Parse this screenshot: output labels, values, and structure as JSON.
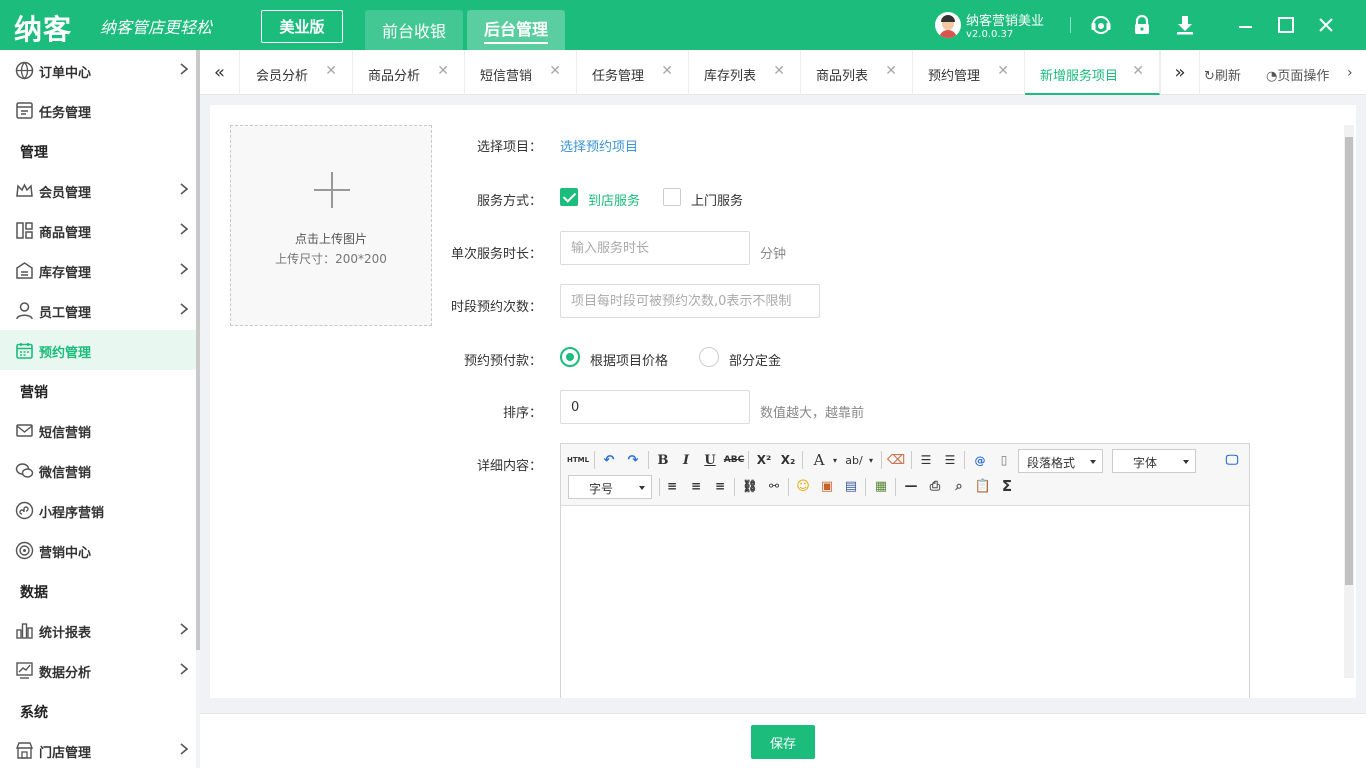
{
  "header": {
    "logo": "纳客",
    "slogan": "纳客管店更轻松",
    "edition": "美业版",
    "front_tab": "前台收银",
    "back_tab": "后台管理",
    "user_name": "纳客营销美业",
    "version": "v2.0.0.37",
    "icons": [
      "support-icon",
      "lock-icon",
      "download-icon",
      "minimize-icon",
      "maximize-icon",
      "close-icon"
    ]
  },
  "sidebar": {
    "items": [
      {
        "label": "订单中心",
        "icon": "globe-icon",
        "chevron": true
      },
      {
        "label": "任务管理",
        "icon": "task-icon",
        "chevron": false
      },
      {
        "label": "会员管理",
        "icon": "crown-icon",
        "chevron": true
      },
      {
        "label": "商品管理",
        "icon": "goods-icon",
        "chevron": true
      },
      {
        "label": "库存管理",
        "icon": "warehouse-icon",
        "chevron": true
      },
      {
        "label": "员工管理",
        "icon": "person-icon",
        "chevron": true
      },
      {
        "label": "预约管理",
        "icon": "calendar-icon",
        "chevron": false,
        "active": true
      },
      {
        "label": "短信营销",
        "icon": "mail-icon",
        "chevron": false
      },
      {
        "label": "微信营销",
        "icon": "wechat-icon",
        "chevron": false
      },
      {
        "label": "小程序营销",
        "icon": "miniprogram-icon",
        "chevron": false
      },
      {
        "label": "营销中心",
        "icon": "target-icon",
        "chevron": false
      },
      {
        "label": "统计报表",
        "icon": "bar-chart-icon",
        "chevron": true
      },
      {
        "label": "数据分析",
        "icon": "trend-icon",
        "chevron": true
      },
      {
        "label": "门店管理",
        "icon": "store-icon",
        "chevron": true
      }
    ],
    "sections": [
      "管理",
      "营销",
      "数据",
      "系统"
    ]
  },
  "tabs": {
    "items": [
      "会员分析",
      "商品分析",
      "短信营销",
      "任务管理",
      "库存列表",
      "商品列表",
      "预约管理",
      "新增服务项目"
    ],
    "active": "新增服务项目",
    "refresh": "刷新",
    "page_ops": "页面操作"
  },
  "upload": {
    "line1": "点击上传图片",
    "line2": "上传尺寸：200*200"
  },
  "form": {
    "project_label": "选择项目：",
    "project_link": "选择预约项目",
    "service_label": "服务方式：",
    "in_store": "到店服务",
    "on_site": "上门服务",
    "duration_label": "单次服务时长：",
    "duration_placeholder": "输入服务时长",
    "duration_unit": "分钟",
    "times_label": "时段预约次数：",
    "times_placeholder": "项目每时段可被预约次数,0表示不限制",
    "prepay_label": "预约预付款：",
    "prepay_opt1": "根据项目价格",
    "prepay_opt2": "部分定金",
    "sort_label": "排序：",
    "sort_value": "0",
    "sort_hint": "数值越大，越靠前",
    "detail_label": "详细内容："
  },
  "editor": {
    "paragraph": "段落格式",
    "font": "字体",
    "size": "字号",
    "html": "HTML"
  },
  "footer": {
    "save": "保存"
  },
  "colors": {
    "brand": "#1bbc7c",
    "link": "#3b95d6"
  }
}
